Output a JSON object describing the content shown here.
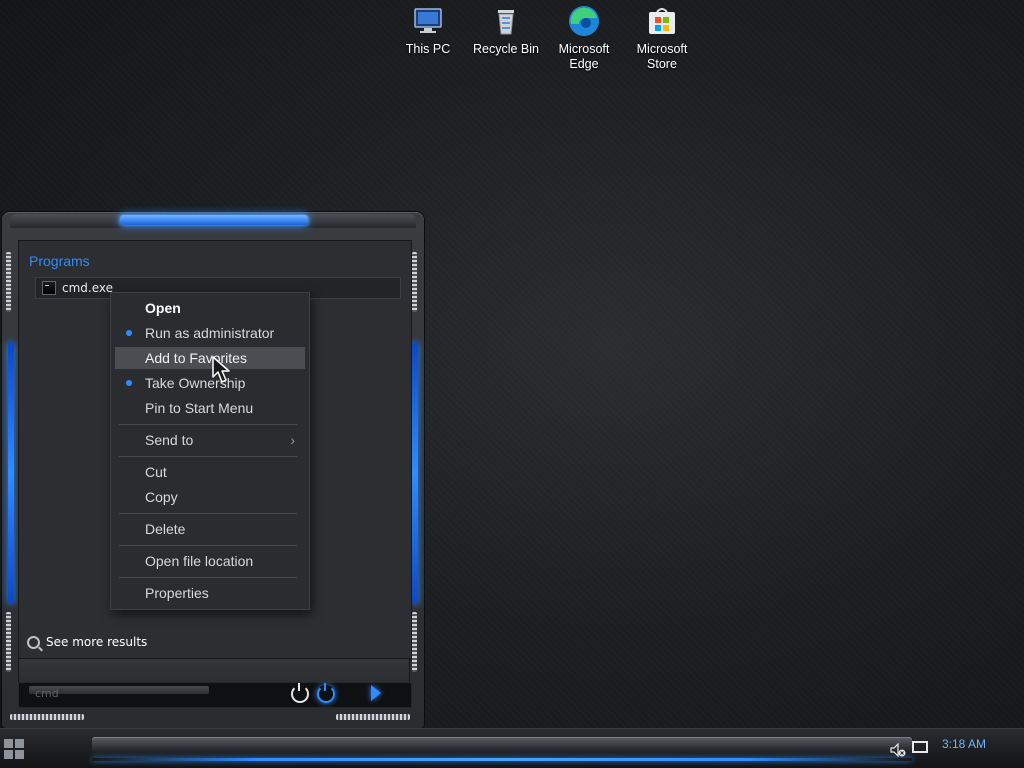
{
  "desktop": {
    "icons": [
      {
        "label_line1": "This PC",
        "label_line2": "",
        "icon": "this-pc-icon"
      },
      {
        "label_line1": "Recycle Bin",
        "label_line2": "",
        "icon": "recycle-bin-icon"
      },
      {
        "label_line1": "Microsoft",
        "label_line2": "Edge",
        "icon": "edge-icon"
      },
      {
        "label_line1": "Microsoft",
        "label_line2": "Store",
        "icon": "store-icon"
      }
    ]
  },
  "start_menu": {
    "section_title": "Programs",
    "program_item": "cmd.exe",
    "see_more": "See more results",
    "search_value": "cmd"
  },
  "context_menu": {
    "items": [
      {
        "label": "Open",
        "bold": true
      },
      {
        "label": "Run as administrator",
        "dot": true
      },
      {
        "label": "Add to Favorites",
        "highlighted": true
      },
      {
        "label": "Take Ownership",
        "dot": true
      },
      {
        "label": "Pin to Start Menu"
      },
      {
        "label": "Send to",
        "submenu": true
      },
      {
        "label": "Cut"
      },
      {
        "label": "Copy"
      },
      {
        "label": "Delete"
      },
      {
        "label": "Open file location"
      },
      {
        "label": "Properties"
      }
    ],
    "submenu_chevron": "›"
  },
  "taskbar": {
    "clock": "3:18 AM"
  },
  "colors": {
    "accent": "#2f8cff",
    "clock": "#6cb4ff"
  }
}
